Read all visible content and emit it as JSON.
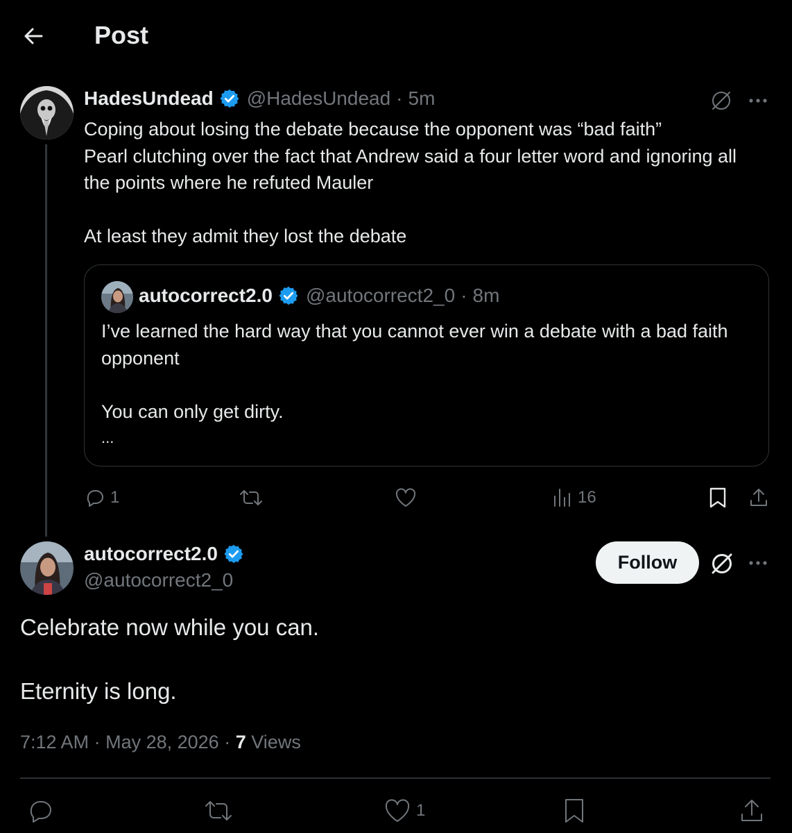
{
  "header": {
    "title": "Post"
  },
  "parent_post": {
    "name": "HadesUndead",
    "handle": "@HadesUndead",
    "time": "5m",
    "body": "Coping about losing the debate because the opponent was “bad faith”\nPearl clutching over the fact that Andrew said a four letter word and ignoring all the points where he refuted Mauler\n\nAt least they admit they lost the debate",
    "quote": {
      "name": "autocorrect2.0",
      "handle": "@autocorrect2_0",
      "time": "8m",
      "body": "I’ve learned the hard way that you cannot ever win a debate with a bad faith opponent\n\nYou can only get dirty.",
      "ellipsis": "..."
    },
    "actions": {
      "replies": "1",
      "views": "16"
    }
  },
  "main_post": {
    "name": "autocorrect2.0",
    "handle": "@autocorrect2_0",
    "follow_label": "Follow",
    "body_line1": "Celebrate now while you can.",
    "body_line2": "Eternity is long.",
    "time": "7:12 AM",
    "date": "May 28, 2026",
    "views_count": "7",
    "views_label": "Views",
    "separator": "·"
  },
  "bottom_bar": {
    "likes": "1"
  },
  "colors": {
    "background": "#000000",
    "text": "#e7e9ea",
    "muted": "#71767b",
    "verified": "#1d9bf0",
    "divider": "#2f3336"
  },
  "icons": [
    "back-arrow-icon",
    "verified-badge-icon",
    "grok-icon",
    "more-icon",
    "reply-icon",
    "repost-icon",
    "like-icon",
    "views-icon",
    "bookmark-icon",
    "share-icon"
  ]
}
